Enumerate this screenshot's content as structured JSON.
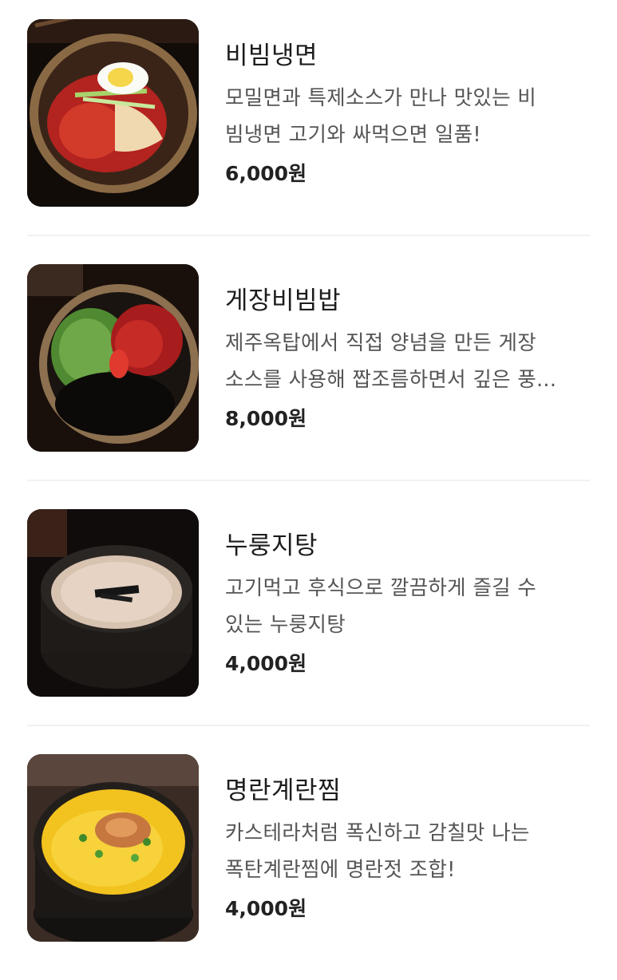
{
  "menu": {
    "items": [
      {
        "name": "비빔냉면",
        "desc_lines": [
          "모밀면과 특제소스가 만나 맛있는 비",
          "빔냉면 고기와 싸먹으면 일품!"
        ],
        "price": "6,000원"
      },
      {
        "name": "게장비빔밥",
        "desc_lines": [
          "제주옥탑에서 직접 양념을 만든 게장",
          "소스를 사용해 짭조름하면서 깊은 풍..."
        ],
        "price": "8,000원"
      },
      {
        "name": "누룽지탕",
        "desc_lines": [
          "고기먹고 후식으로 깔끔하게 즐길 수",
          "있는 누룽지탕"
        ],
        "price": "4,000원"
      },
      {
        "name": "명란계란찜",
        "desc_lines": [
          "카스테라처럼 폭신하고 감칠맛 나는",
          "폭탄계란찜에 명란젓 조합!"
        ],
        "price": "4,000원"
      }
    ]
  }
}
